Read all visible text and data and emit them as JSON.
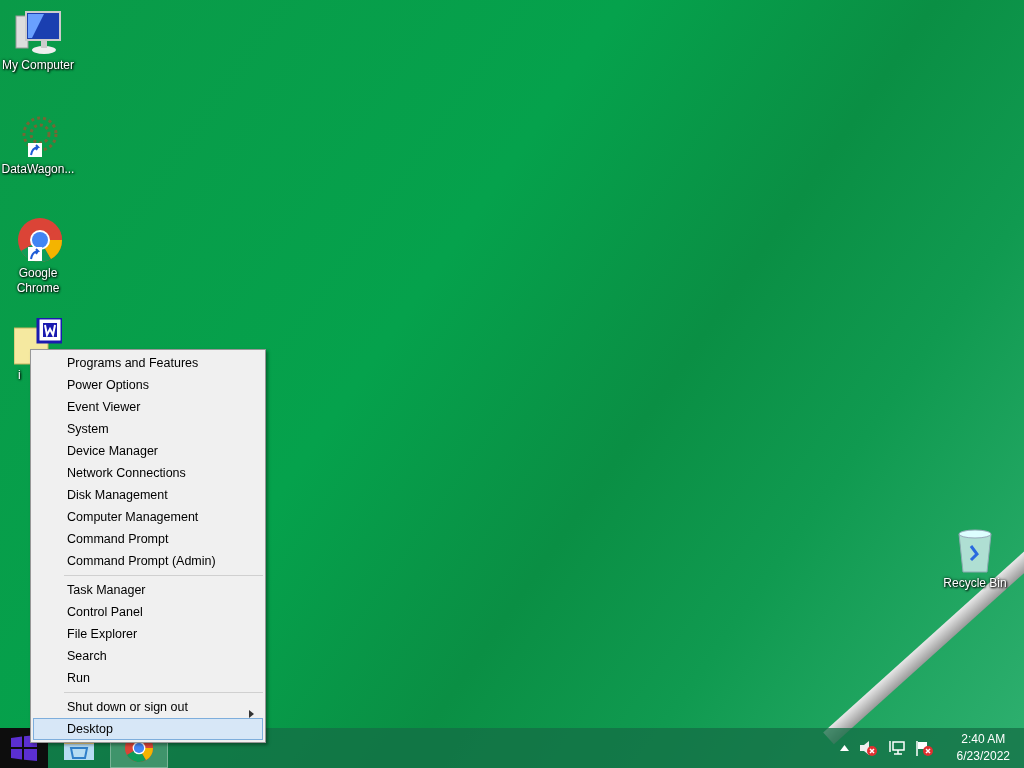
{
  "desktop_icons": [
    {
      "kind": "computer",
      "label": "My Computer",
      "shortcut": false
    },
    {
      "kind": "app",
      "label": "DataWagon...",
      "shortcut": true
    },
    {
      "kind": "chrome",
      "label": "Google Chrome",
      "shortcut": true
    },
    {
      "kind": "document",
      "label": "i",
      "shortcut": false
    },
    {
      "kind": "recycle",
      "label": "Recycle Bin",
      "shortcut": false
    }
  ],
  "context_menu": {
    "groups": [
      [
        {
          "label": "Programs and Features",
          "selected": false,
          "has_submenu": false
        },
        {
          "label": "Power Options",
          "selected": false,
          "has_submenu": false
        },
        {
          "label": "Event Viewer",
          "selected": false,
          "has_submenu": false
        },
        {
          "label": "System",
          "selected": false,
          "has_submenu": false
        },
        {
          "label": "Device Manager",
          "selected": false,
          "has_submenu": false
        },
        {
          "label": "Network Connections",
          "selected": false,
          "has_submenu": false
        },
        {
          "label": "Disk Management",
          "selected": false,
          "has_submenu": false
        },
        {
          "label": "Computer Management",
          "selected": false,
          "has_submenu": false
        },
        {
          "label": "Command Prompt",
          "selected": false,
          "has_submenu": false
        },
        {
          "label": "Command Prompt (Admin)",
          "selected": false,
          "has_submenu": false
        }
      ],
      [
        {
          "label": "Task Manager",
          "selected": false,
          "has_submenu": false
        },
        {
          "label": "Control Panel",
          "selected": false,
          "has_submenu": false
        },
        {
          "label": "File Explorer",
          "selected": false,
          "has_submenu": false
        },
        {
          "label": "Search",
          "selected": false,
          "has_submenu": false
        },
        {
          "label": "Run",
          "selected": false,
          "has_submenu": false
        }
      ],
      [
        {
          "label": "Shut down or sign out",
          "selected": false,
          "has_submenu": true
        },
        {
          "label": "Desktop",
          "selected": true,
          "has_submenu": false
        }
      ]
    ]
  },
  "taskbar": {
    "apps": [
      {
        "kind": "explorer",
        "active": false
      },
      {
        "kind": "chrome",
        "active": true
      }
    ],
    "tray": {
      "time": "2:40 AM",
      "date": "6/23/2022"
    }
  }
}
